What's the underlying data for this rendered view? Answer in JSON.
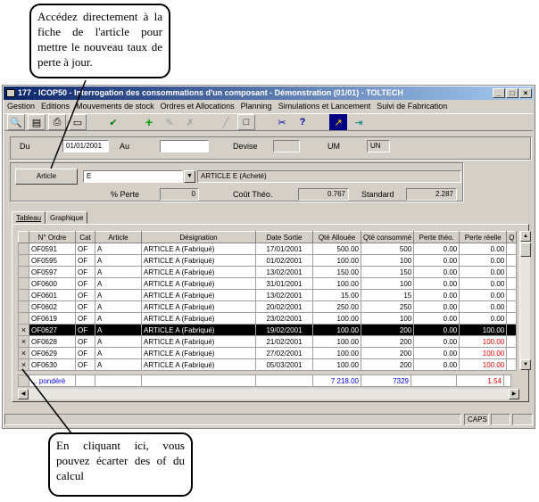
{
  "callouts": {
    "top": "Accédez directement à la fiche de l'article pour mettre le nouveau taux de perte à jour.",
    "bottom": "En cliquant ici, vous pouvez écarter des of du calcul"
  },
  "window": {
    "title": "177 - ICOP50 - Interrogation des consommations d'un composant - Démonstration (01/01) - TOLTECH",
    "buttons": [
      "_",
      "□",
      "×"
    ]
  },
  "menu": [
    "Gestion",
    "Editions",
    "Mouvements de stock",
    "Ordres et Allocations",
    "Planning",
    "Simulations et Lancement",
    "Suivi de Fabrication"
  ],
  "toolbar": [
    "preview-icon",
    "printer-icon",
    "print-icon",
    "form-icon",
    "validate-icon",
    "add-icon",
    "edit-icon",
    "delete-icon",
    "pen-icon",
    "page-icon",
    "tools-icon",
    "help-icon",
    "chart-icon",
    "exit-icon"
  ],
  "filters": {
    "du_label": "Du",
    "du_value": "01/01/2001",
    "au_label": "Au",
    "au_value": "",
    "devise_label": "Devise",
    "devise_value": "",
    "um_label": "UM",
    "um_value": "UN"
  },
  "article": {
    "button_label": "Article",
    "code": "E",
    "description": "ARTICLE E (Acheté)",
    "perte_label": "% Perte",
    "perte_value": "0",
    "cout_label": "Coût Théo.",
    "cout_value": "0.767",
    "standard_label": "Standard",
    "standard_value": "2.287"
  },
  "tabs": [
    "Tableau",
    "Graphique"
  ],
  "table": {
    "headers": [
      "N° Ordre",
      "Cat",
      "Article",
      "Désignation",
      "Date Sortie",
      "Qté Allouée",
      "Qté consommé",
      "Perte théo.",
      "Perte réelle",
      "Q"
    ],
    "rows": [
      {
        "excl": "",
        "ordre": "OF0591",
        "cat": "OF",
        "article": "A",
        "designation": "ARTICLE A (Fabriqué)",
        "date": "17/01/2001",
        "alloue": "500.00",
        "consomme": "500",
        "perte_theo": "0.00",
        "perte_reelle": "0.00"
      },
      {
        "excl": "",
        "ordre": "OF0595",
        "cat": "OF",
        "article": "A",
        "designation": "ARTICLE A (Fabriqué)",
        "date": "01/02/2001",
        "alloue": "100.00",
        "consomme": "100",
        "perte_theo": "0.00",
        "perte_reelle": "0.00"
      },
      {
        "excl": "",
        "ordre": "OF0597",
        "cat": "OF",
        "article": "A",
        "designation": "ARTICLE A (Fabriqué)",
        "date": "13/02/2001",
        "alloue": "150.00",
        "consomme": "150",
        "perte_theo": "0.00",
        "perte_reelle": "0.00"
      },
      {
        "excl": "",
        "ordre": "OF0600",
        "cat": "OF",
        "article": "A",
        "designation": "ARTICLE A (Fabriqué)",
        "date": "31/01/2001",
        "alloue": "100.00",
        "consomme": "100",
        "perte_theo": "0.00",
        "perte_reelle": "0.00"
      },
      {
        "excl": "",
        "ordre": "OF0601",
        "cat": "OF",
        "article": "A",
        "designation": "ARTICLE A (Fabriqué)",
        "date": "13/02/2001",
        "alloue": "15.00",
        "consomme": "15",
        "perte_theo": "0.00",
        "perte_reelle": "0.00"
      },
      {
        "excl": "",
        "ordre": "OF0602",
        "cat": "OF",
        "article": "A",
        "designation": "ARTICLE A (Fabriqué)",
        "date": "20/02/2001",
        "alloue": "250.00",
        "consomme": "250",
        "perte_theo": "0.00",
        "perte_reelle": "0.00"
      },
      {
        "excl": "",
        "ordre": "OF0619",
        "cat": "OF",
        "article": "A",
        "designation": "ARTICLE A (Fabriqué)",
        "date": "23/02/2001",
        "alloue": "100.00",
        "consomme": "100",
        "perte_theo": "0.00",
        "perte_reelle": "0.00"
      },
      {
        "excl": "×",
        "ordre": "OF0627",
        "cat": "OF",
        "article": "A",
        "designation": "ARTICLE A (Fabriqué)",
        "date": "19/02/2001",
        "alloue": "100.00",
        "consomme": "200",
        "perte_theo": "0.00",
        "perte_reelle": "100.00",
        "highlight": true
      },
      {
        "excl": "×",
        "ordre": "OF0628",
        "cat": "OF",
        "article": "A",
        "designation": "ARTICLE A (Fabriqué)",
        "date": "21/02/2001",
        "alloue": "100.00",
        "consomme": "200",
        "perte_theo": "0.00",
        "perte_reelle": "100.00"
      },
      {
        "excl": "×",
        "ordre": "OF0629",
        "cat": "OF",
        "article": "A",
        "designation": "ARTICLE A (Fabriqué)",
        "date": "27/02/2001",
        "alloue": "100.00",
        "consomme": "200",
        "perte_theo": "0.00",
        "perte_reelle": "100.00"
      },
      {
        "excl": "×",
        "ordre": "OF0630",
        "cat": "OF",
        "article": "A",
        "designation": "ARTICLE A (Fabriqué)",
        "date": "05/03/2001",
        "alloue": "100.00",
        "consomme": "200",
        "perte_theo": "0.00",
        "perte_reelle": "100.00"
      }
    ],
    "total": {
      "label": "... pondéré",
      "alloue": "7 218.00",
      "consomme": "7329",
      "perte_reelle": "1.54"
    }
  },
  "status": {
    "caps": "CAPS"
  },
  "colors": {
    "title_start": "#0a246a",
    "title_end": "#a6caf0",
    "loss_red": "#e00000",
    "loss_green": "#00d060",
    "total_blue": "#0000e0"
  }
}
